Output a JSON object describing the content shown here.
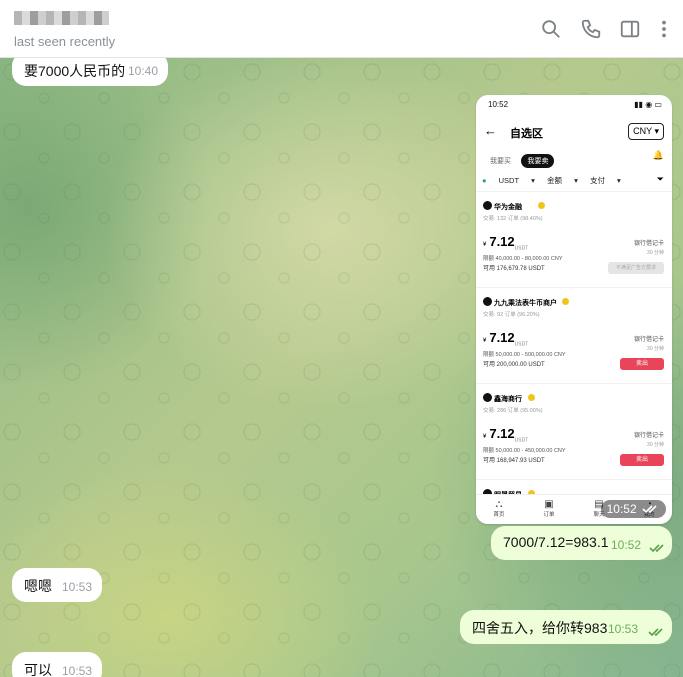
{
  "header": {
    "status": "last seen recently"
  },
  "messages": [
    {
      "dir": "in",
      "text": "要7000人民币的",
      "time": "10:40"
    },
    {
      "dir": "out",
      "type": "photo",
      "time": "10:52"
    },
    {
      "dir": "out",
      "text": "7000/7.12=983.1",
      "time": "10:52"
    },
    {
      "dir": "in",
      "text": "嗯嗯",
      "time": "10:53"
    },
    {
      "dir": "out",
      "text": "四舍五入，给你转983",
      "time": "10:53"
    },
    {
      "dir": "in",
      "text": "可以",
      "time": "10:53"
    }
  ],
  "photo": {
    "status_time": "10:52",
    "title": "自选区",
    "currency": "CNY",
    "tabs": [
      "我要买",
      "我要卖"
    ],
    "filters": [
      "USDT",
      "金额",
      "支付"
    ],
    "offers": [
      {
        "name": "华为金融",
        "stats": "交易: 132 订单 (98.40%)",
        "price": "7.12",
        "limit": "限额 40,000.00 - 80,000.00 CNY",
        "avail": "可用 176,679.78 USDT",
        "pay": "银行借记卡",
        "mins": "30 分钟",
        "action": "不满足广告方要求"
      },
      {
        "name": "九九乘法表牛币商户",
        "stats": "交易: 92 订单 (96.20%)",
        "price": "7.12",
        "limit": "限额 50,000.00 - 500,000.00 CNY",
        "avail": "可用 200,000.00 USDT",
        "pay": "银行借记卡",
        "mins": "30 分钟",
        "action": "卖出"
      },
      {
        "name": "鑫海商行",
        "stats": "交易: 286 订单 (95.00%)",
        "price": "7.12",
        "limit": "限额 50,000.00 - 450,000.00 CNY",
        "avail": "可用 168,947.93 USDT",
        "pay": "银行借记卡",
        "mins": "30 分钟",
        "action": "卖出"
      },
      {
        "name": "明晟贸易"
      }
    ],
    "currency_symbol": "¥",
    "unit": "USDT",
    "nav": [
      "首页",
      "订单",
      "聊天",
      "我的"
    ]
  }
}
